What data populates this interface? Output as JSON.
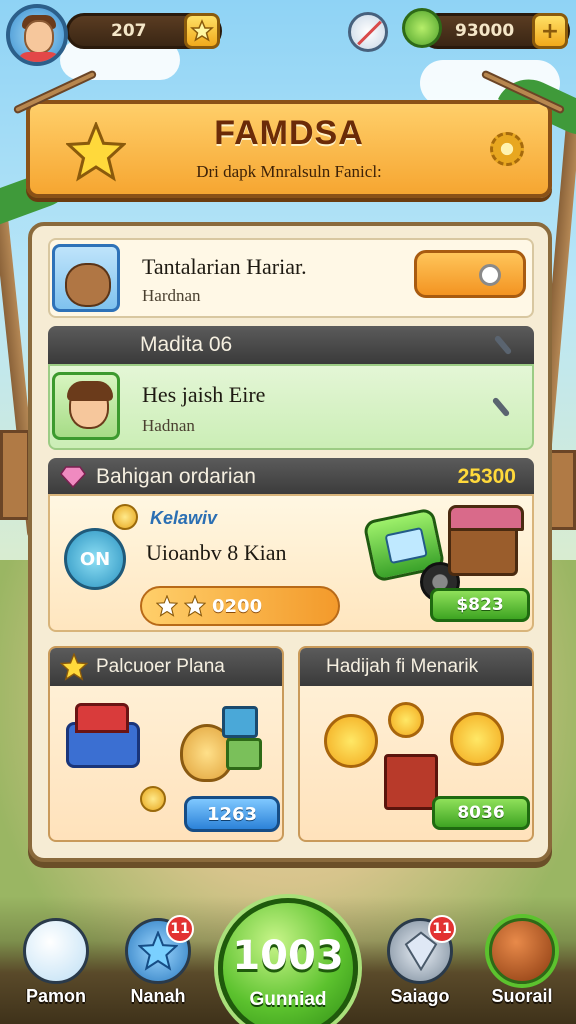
{
  "hud": {
    "level_value": "207",
    "gem_value": "93000",
    "add_label": "+"
  },
  "banner": {
    "title": "FAMDSA",
    "subtitle": "Dri dapk Mnralsuln Fanicl:"
  },
  "task_row": {
    "title": "Tantalarian Hariar.",
    "subtitle": "Hardnan"
  },
  "section_madita": {
    "header": "Madita 06",
    "title": "Hes jaish Eire",
    "subtitle": "Hadnan"
  },
  "promo": {
    "header": "Bahigan ordarian",
    "header_value": "25300",
    "badge_label": "ON",
    "tag": "Kelawiv",
    "title": "Uioanbv 8 Kian",
    "bar_value": "0200",
    "price": "$823"
  },
  "card_left": {
    "header": "Palcuoer Plana",
    "price": "1263"
  },
  "card_right": {
    "header": "Hadijah fi Menarik",
    "price": "8036"
  },
  "nav": {
    "items": [
      {
        "label": "Pamon",
        "icon": "yeti-icon"
      },
      {
        "label": "Nanah",
        "icon": "star-shield-icon",
        "badge": "11"
      },
      {
        "label": "Gunniad",
        "value": "1003",
        "icon": "green-orb-icon"
      },
      {
        "label": "Saiago",
        "icon": "crystal-icon",
        "badge": "11"
      },
      {
        "label": "Suorail",
        "icon": "coconut-icon"
      }
    ]
  },
  "colors": {
    "accent_orange": "#f6a631",
    "panel_bg": "#f6ecd4",
    "green_button": "#3ea422",
    "blue_button": "#2c82d8",
    "header_dark": "#3a3a3a"
  }
}
